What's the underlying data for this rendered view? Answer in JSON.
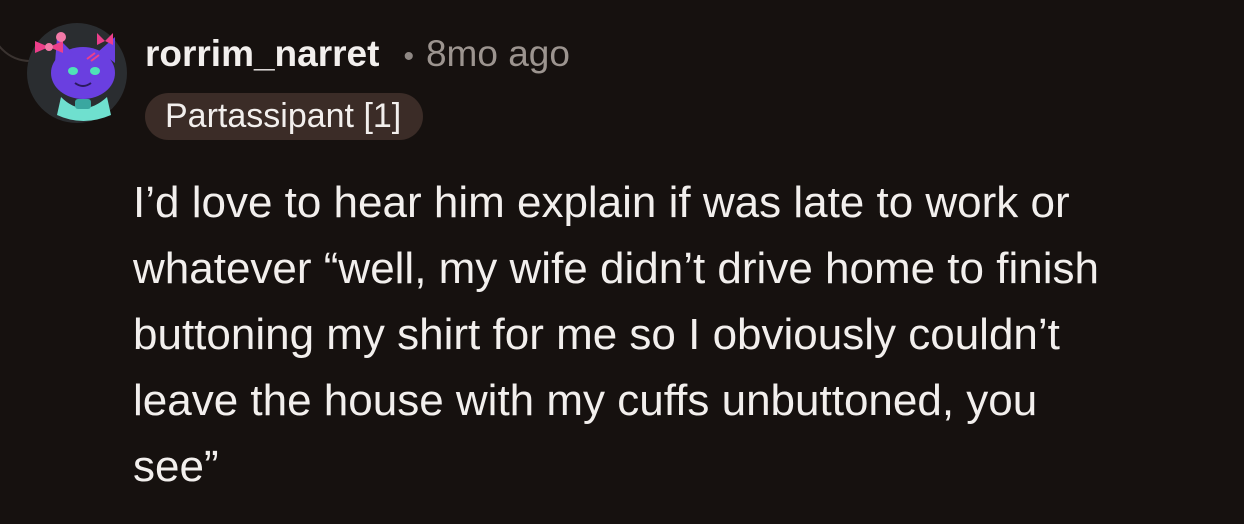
{
  "comment": {
    "username": "rorrim_narret",
    "separator": "•",
    "timestamp": "8mo ago",
    "flair": "Partassipant [1]",
    "body": "I’d love to hear him explain if was late to work or\nwhatever “well, my wife didn’t drive home to finish\nbuttoning my shirt for me so I obviously couldn’t\nleave the house with my cuffs unbuttoned, you\nsee”",
    "avatar_icon": "snoo-avatar-icon"
  },
  "colors": {
    "background": "#16110f",
    "text": "#f2efed",
    "muted": "#9c948f",
    "flair_background": "#3b2c27",
    "avatar_purple": "#6a3fe0",
    "avatar_teal": "#6fe0cf"
  }
}
